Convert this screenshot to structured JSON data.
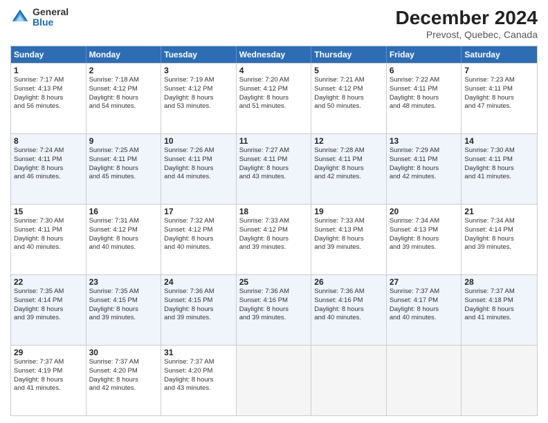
{
  "logo": {
    "general": "General",
    "blue": "Blue"
  },
  "title": "December 2024",
  "location": "Prevost, Quebec, Canada",
  "days": [
    "Sunday",
    "Monday",
    "Tuesday",
    "Wednesday",
    "Thursday",
    "Friday",
    "Saturday"
  ],
  "weeks": [
    [
      {
        "day": "1",
        "sunrise": "Sunrise: 7:17 AM",
        "sunset": "Sunset: 4:13 PM",
        "daylight": "Daylight: 8 hours",
        "daylight2": "and 56 minutes."
      },
      {
        "day": "2",
        "sunrise": "Sunrise: 7:18 AM",
        "sunset": "Sunset: 4:12 PM",
        "daylight": "Daylight: 8 hours",
        "daylight2": "and 54 minutes."
      },
      {
        "day": "3",
        "sunrise": "Sunrise: 7:19 AM",
        "sunset": "Sunset: 4:12 PM",
        "daylight": "Daylight: 8 hours",
        "daylight2": "and 53 minutes."
      },
      {
        "day": "4",
        "sunrise": "Sunrise: 7:20 AM",
        "sunset": "Sunset: 4:12 PM",
        "daylight": "Daylight: 8 hours",
        "daylight2": "and 51 minutes."
      },
      {
        "day": "5",
        "sunrise": "Sunrise: 7:21 AM",
        "sunset": "Sunset: 4:12 PM",
        "daylight": "Daylight: 8 hours",
        "daylight2": "and 50 minutes."
      },
      {
        "day": "6",
        "sunrise": "Sunrise: 7:22 AM",
        "sunset": "Sunset: 4:11 PM",
        "daylight": "Daylight: 8 hours",
        "daylight2": "and 48 minutes."
      },
      {
        "day": "7",
        "sunrise": "Sunrise: 7:23 AM",
        "sunset": "Sunset: 4:11 PM",
        "daylight": "Daylight: 8 hours",
        "daylight2": "and 47 minutes."
      }
    ],
    [
      {
        "day": "8",
        "sunrise": "Sunrise: 7:24 AM",
        "sunset": "Sunset: 4:11 PM",
        "daylight": "Daylight: 8 hours",
        "daylight2": "and 46 minutes."
      },
      {
        "day": "9",
        "sunrise": "Sunrise: 7:25 AM",
        "sunset": "Sunset: 4:11 PM",
        "daylight": "Daylight: 8 hours",
        "daylight2": "and 45 minutes."
      },
      {
        "day": "10",
        "sunrise": "Sunrise: 7:26 AM",
        "sunset": "Sunset: 4:11 PM",
        "daylight": "Daylight: 8 hours",
        "daylight2": "and 44 minutes."
      },
      {
        "day": "11",
        "sunrise": "Sunrise: 7:27 AM",
        "sunset": "Sunset: 4:11 PM",
        "daylight": "Daylight: 8 hours",
        "daylight2": "and 43 minutes."
      },
      {
        "day": "12",
        "sunrise": "Sunrise: 7:28 AM",
        "sunset": "Sunset: 4:11 PM",
        "daylight": "Daylight: 8 hours",
        "daylight2": "and 42 minutes."
      },
      {
        "day": "13",
        "sunrise": "Sunrise: 7:29 AM",
        "sunset": "Sunset: 4:11 PM",
        "daylight": "Daylight: 8 hours",
        "daylight2": "and 42 minutes."
      },
      {
        "day": "14",
        "sunrise": "Sunrise: 7:30 AM",
        "sunset": "Sunset: 4:11 PM",
        "daylight": "Daylight: 8 hours",
        "daylight2": "and 41 minutes."
      }
    ],
    [
      {
        "day": "15",
        "sunrise": "Sunrise: 7:30 AM",
        "sunset": "Sunset: 4:11 PM",
        "daylight": "Daylight: 8 hours",
        "daylight2": "and 40 minutes."
      },
      {
        "day": "16",
        "sunrise": "Sunrise: 7:31 AM",
        "sunset": "Sunset: 4:12 PM",
        "daylight": "Daylight: 8 hours",
        "daylight2": "and 40 minutes."
      },
      {
        "day": "17",
        "sunrise": "Sunrise: 7:32 AM",
        "sunset": "Sunset: 4:12 PM",
        "daylight": "Daylight: 8 hours",
        "daylight2": "and 40 minutes."
      },
      {
        "day": "18",
        "sunrise": "Sunrise: 7:33 AM",
        "sunset": "Sunset: 4:12 PM",
        "daylight": "Daylight: 8 hours",
        "daylight2": "and 39 minutes."
      },
      {
        "day": "19",
        "sunrise": "Sunrise: 7:33 AM",
        "sunset": "Sunset: 4:13 PM",
        "daylight": "Daylight: 8 hours",
        "daylight2": "and 39 minutes."
      },
      {
        "day": "20",
        "sunrise": "Sunrise: 7:34 AM",
        "sunset": "Sunset: 4:13 PM",
        "daylight": "Daylight: 8 hours",
        "daylight2": "and 39 minutes."
      },
      {
        "day": "21",
        "sunrise": "Sunrise: 7:34 AM",
        "sunset": "Sunset: 4:14 PM",
        "daylight": "Daylight: 8 hours",
        "daylight2": "and 39 minutes."
      }
    ],
    [
      {
        "day": "22",
        "sunrise": "Sunrise: 7:35 AM",
        "sunset": "Sunset: 4:14 PM",
        "daylight": "Daylight: 8 hours",
        "daylight2": "and 39 minutes."
      },
      {
        "day": "23",
        "sunrise": "Sunrise: 7:35 AM",
        "sunset": "Sunset: 4:15 PM",
        "daylight": "Daylight: 8 hours",
        "daylight2": "and 39 minutes."
      },
      {
        "day": "24",
        "sunrise": "Sunrise: 7:36 AM",
        "sunset": "Sunset: 4:15 PM",
        "daylight": "Daylight: 8 hours",
        "daylight2": "and 39 minutes."
      },
      {
        "day": "25",
        "sunrise": "Sunrise: 7:36 AM",
        "sunset": "Sunset: 4:16 PM",
        "daylight": "Daylight: 8 hours",
        "daylight2": "and 39 minutes."
      },
      {
        "day": "26",
        "sunrise": "Sunrise: 7:36 AM",
        "sunset": "Sunset: 4:16 PM",
        "daylight": "Daylight: 8 hours",
        "daylight2": "and 40 minutes."
      },
      {
        "day": "27",
        "sunrise": "Sunrise: 7:37 AM",
        "sunset": "Sunset: 4:17 PM",
        "daylight": "Daylight: 8 hours",
        "daylight2": "and 40 minutes."
      },
      {
        "day": "28",
        "sunrise": "Sunrise: 7:37 AM",
        "sunset": "Sunset: 4:18 PM",
        "daylight": "Daylight: 8 hours",
        "daylight2": "and 41 minutes."
      }
    ],
    [
      {
        "day": "29",
        "sunrise": "Sunrise: 7:37 AM",
        "sunset": "Sunset: 4:19 PM",
        "daylight": "Daylight: 8 hours",
        "daylight2": "and 41 minutes."
      },
      {
        "day": "30",
        "sunrise": "Sunrise: 7:37 AM",
        "sunset": "Sunset: 4:20 PM",
        "daylight": "Daylight: 8 hours",
        "daylight2": "and 42 minutes."
      },
      {
        "day": "31",
        "sunrise": "Sunrise: 7:37 AM",
        "sunset": "Sunset: 4:20 PM",
        "daylight": "Daylight: 8 hours",
        "daylight2": "and 43 minutes."
      },
      null,
      null,
      null,
      null
    ]
  ]
}
